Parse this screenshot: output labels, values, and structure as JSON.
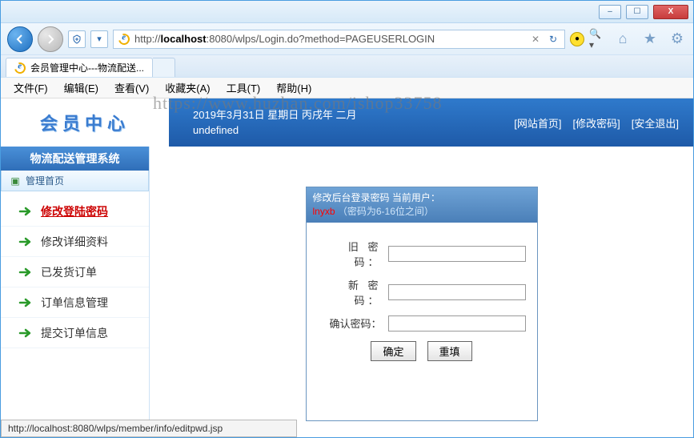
{
  "window": {
    "min_tip": "–",
    "max_tip": "☐",
    "close_tip": "X"
  },
  "browser": {
    "url_display": "http://localhost:8080/wlps/Login.do?method=PAGEUSERLOGIN",
    "url_host": "localhost",
    "tab_title": "会员管理中心---物流配送...",
    "refresh_glyph": "↻",
    "stop_glyph": "✕",
    "dropdown_glyph": "▾",
    "home_glyph": "⌂",
    "star_glyph": "★",
    "gear_glyph": "⚙"
  },
  "menus": {
    "file": "文件(F)",
    "edit": "编辑(E)",
    "view": "查看(V)",
    "favorites": "收藏夹(A)",
    "tools": "工具(T)",
    "help": "帮助(H)"
  },
  "watermark": "https://www.huzhan.com/ishop33758",
  "header": {
    "logo": "会员中心",
    "date_line": "2019年3月31日 星期日 丙戌年 二月",
    "sub_line": "undefined",
    "link_home": "[网站首页]",
    "link_pwd": "[修改密码]",
    "link_exit": "[安全退出]"
  },
  "sidebar": {
    "title": "物流配送管理系统",
    "home": "管理首页",
    "items": [
      {
        "label": "修改登陆密码",
        "active": true
      },
      {
        "label": "修改详细资料",
        "active": false
      },
      {
        "label": "已发货订单",
        "active": false
      },
      {
        "label": "订单信息管理",
        "active": false
      },
      {
        "label": "提交订单信息",
        "active": false
      }
    ]
  },
  "panel": {
    "head_prefix": "修改后台登录密码 当前用户：",
    "user": "lnyxb",
    "head_suffix": "（密码为6-16位之间）",
    "label_old": "旧 密 码：",
    "label_new": "新 密 码：",
    "label_confirm": "确认密码：",
    "btn_ok": "确定",
    "btn_reset": "重填"
  },
  "status": {
    "text": "http://localhost:8080/wlps/member/info/editpwd.jsp"
  }
}
